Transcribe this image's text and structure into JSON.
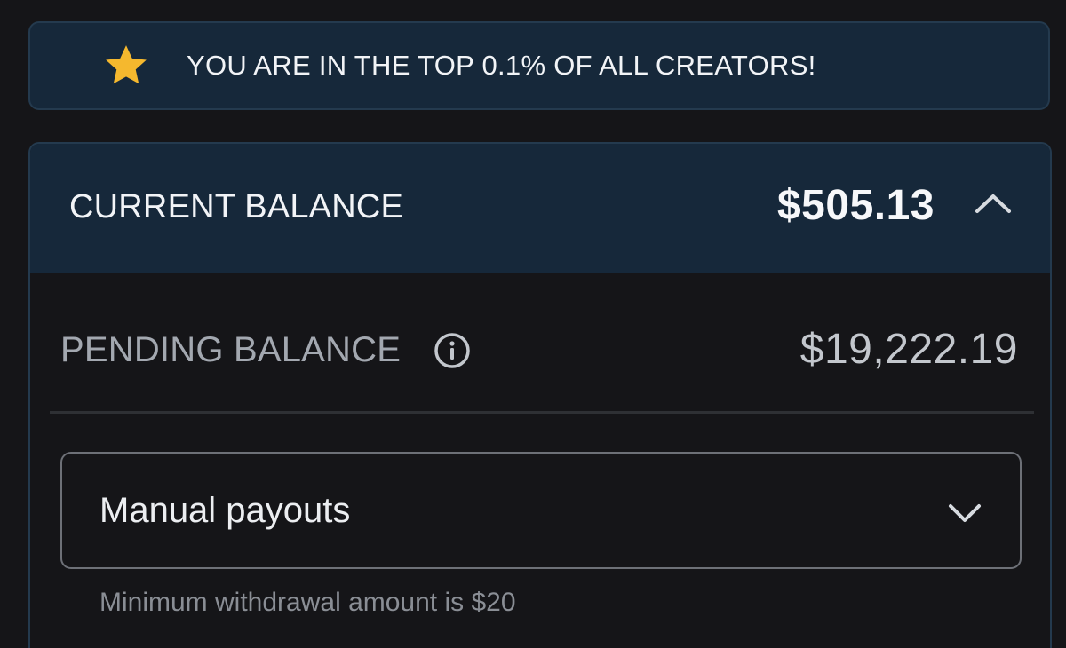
{
  "banner": {
    "text": "YOU ARE IN THE TOP 0.1% OF ALL CREATORS!",
    "icon": "star-icon",
    "icon_color": "#f5b82e"
  },
  "current_balance": {
    "label": "CURRENT BALANCE",
    "amount": "$505.13",
    "icon": "chevron-up-icon"
  },
  "pending_balance": {
    "label": "PENDING BALANCE",
    "amount": "$19,222.19",
    "icon": "info-icon"
  },
  "payout_select": {
    "value": "Manual payouts",
    "icon": "chevron-down-icon",
    "hint": "Minimum withdrawal amount is $20"
  },
  "colors": {
    "background": "#151518",
    "header_background": "#16283a",
    "accent_star": "#f5b82e"
  }
}
